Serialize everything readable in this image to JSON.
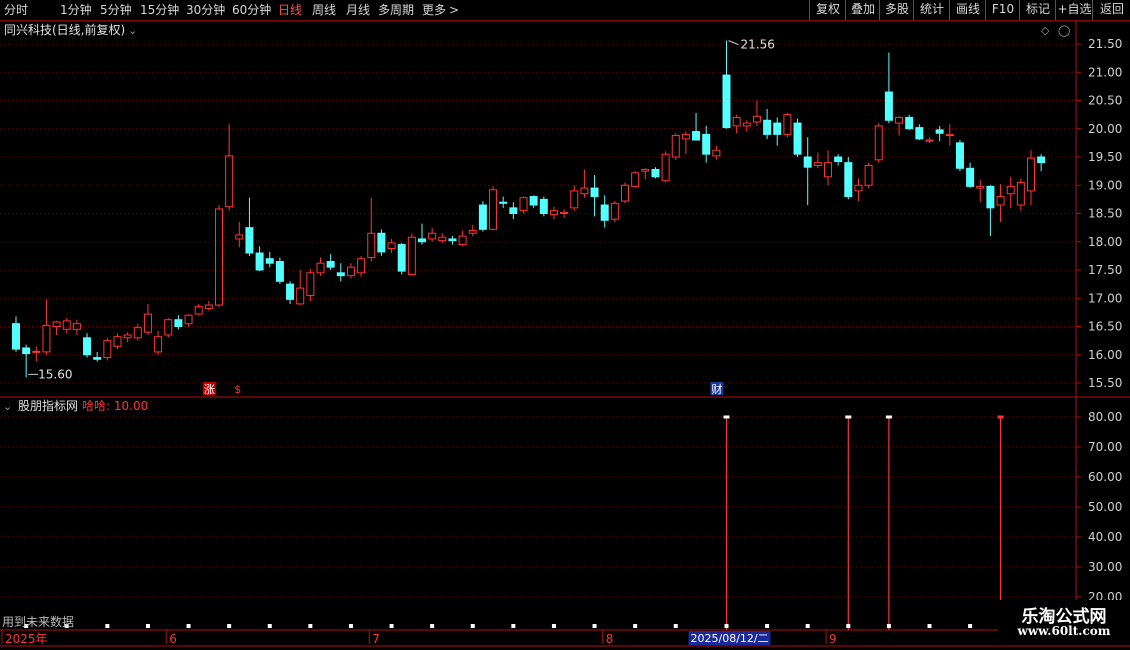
{
  "toolbar": {
    "periods": [
      "分时",
      "1分钟",
      "5分钟",
      "15分钟",
      "30分钟",
      "60分钟",
      "日线",
      "周线",
      "月线",
      "多周期",
      "更多"
    ],
    "active_period": "日线",
    "more_arrow": ">",
    "right_buttons": [
      "复权",
      "叠加",
      "多股",
      "统计",
      "画线",
      "F10",
      "标记",
      "+自选",
      "返回"
    ]
  },
  "price_panel": {
    "title": "同兴科技(日线,前复权)",
    "title_icon": "chevron-down-icon",
    "axis_labels": [
      "21.50",
      "21.00",
      "20.50",
      "20.00",
      "19.50",
      "19.00",
      "18.50",
      "18.00",
      "17.50",
      "17.00",
      "16.50",
      "16.00",
      "15.50"
    ],
    "high_label": "21.56",
    "low_label": "15.60",
    "markers": [
      {
        "text": "涨",
        "color": "#ffffff",
        "bg": "#c00000"
      },
      {
        "text": "$",
        "color": "#ff3030",
        "bg": ""
      },
      {
        "text": "财",
        "color": "#ffffff",
        "bg": "#1a3a9a"
      }
    ]
  },
  "indicator_panel": {
    "title": "股朋指标网",
    "param": "哈哈: 10.00",
    "axis_labels": [
      "80.00",
      "70.00",
      "60.00",
      "50.00",
      "40.00",
      "30.00",
      "20.00"
    ],
    "note": "用到未来数据"
  },
  "x_axis": {
    "labels": [
      "2025年",
      "6",
      "7",
      "8",
      "9"
    ],
    "cursor_date": "2025/08/12/二"
  },
  "watermark": {
    "line1": "乐淘公式网",
    "line2": "www.60lt.com"
  },
  "colors": {
    "up": "#ff3333",
    "down": "#54ffff",
    "frame": "#b01010",
    "grid": "#6e0000",
    "axis_text": "#d0d0d0"
  },
  "chart_data": {
    "type": "candlestick",
    "price_ylim": [
      15.3,
      21.75
    ],
    "indicator_ylim": [
      18,
      82
    ],
    "candles": [
      {
        "o": 16.55,
        "h": 16.68,
        "l": 16.05,
        "c": 16.1
      },
      {
        "o": 16.12,
        "h": 16.18,
        "l": 15.6,
        "c": 16.02
      },
      {
        "o": 16.05,
        "h": 16.15,
        "l": 15.88,
        "c": 16.06
      },
      {
        "o": 16.05,
        "h": 16.98,
        "l": 16.0,
        "c": 16.52
      },
      {
        "o": 16.5,
        "h": 16.6,
        "l": 16.35,
        "c": 16.58
      },
      {
        "o": 16.45,
        "h": 16.65,
        "l": 16.38,
        "c": 16.6
      },
      {
        "o": 16.45,
        "h": 16.62,
        "l": 16.35,
        "c": 16.55
      },
      {
        "o": 16.3,
        "h": 16.38,
        "l": 15.95,
        "c": 16.0
      },
      {
        "o": 15.95,
        "h": 16.05,
        "l": 15.88,
        "c": 15.92
      },
      {
        "o": 15.95,
        "h": 16.3,
        "l": 15.9,
        "c": 16.25
      },
      {
        "o": 16.15,
        "h": 16.38,
        "l": 16.1,
        "c": 16.32
      },
      {
        "o": 16.3,
        "h": 16.4,
        "l": 16.22,
        "c": 16.35
      },
      {
        "o": 16.3,
        "h": 16.55,
        "l": 16.25,
        "c": 16.48
      },
      {
        "o": 16.4,
        "h": 16.9,
        "l": 16.35,
        "c": 16.72
      },
      {
        "o": 16.05,
        "h": 16.42,
        "l": 16.0,
        "c": 16.32
      },
      {
        "o": 16.35,
        "h": 16.65,
        "l": 16.3,
        "c": 16.62
      },
      {
        "o": 16.62,
        "h": 16.7,
        "l": 16.45,
        "c": 16.5
      },
      {
        "o": 16.55,
        "h": 16.72,
        "l": 16.5,
        "c": 16.7
      },
      {
        "o": 16.72,
        "h": 16.9,
        "l": 16.7,
        "c": 16.85
      },
      {
        "o": 16.82,
        "h": 16.95,
        "l": 16.78,
        "c": 16.88
      },
      {
        "o": 16.88,
        "h": 18.65,
        "l": 16.85,
        "c": 18.58
      },
      {
        "o": 18.62,
        "h": 20.08,
        "l": 18.55,
        "c": 19.52
      },
      {
        "o": 18.05,
        "h": 18.35,
        "l": 17.9,
        "c": 18.12
      },
      {
        "o": 18.25,
        "h": 18.78,
        "l": 17.75,
        "c": 17.8
      },
      {
        "o": 17.8,
        "h": 17.92,
        "l": 17.48,
        "c": 17.5
      },
      {
        "o": 17.7,
        "h": 17.82,
        "l": 17.55,
        "c": 17.62
      },
      {
        "o": 17.65,
        "h": 17.72,
        "l": 17.25,
        "c": 17.3
      },
      {
        "o": 17.25,
        "h": 17.3,
        "l": 16.9,
        "c": 16.98
      },
      {
        "o": 16.9,
        "h": 17.5,
        "l": 16.88,
        "c": 17.18
      },
      {
        "o": 17.05,
        "h": 17.52,
        "l": 16.95,
        "c": 17.45
      },
      {
        "o": 17.45,
        "h": 17.72,
        "l": 17.4,
        "c": 17.62
      },
      {
        "o": 17.65,
        "h": 17.78,
        "l": 17.5,
        "c": 17.55
      },
      {
        "o": 17.45,
        "h": 17.62,
        "l": 17.3,
        "c": 17.4
      },
      {
        "o": 17.4,
        "h": 17.62,
        "l": 17.35,
        "c": 17.55
      },
      {
        "o": 17.45,
        "h": 17.75,
        "l": 17.38,
        "c": 17.7
      },
      {
        "o": 17.72,
        "h": 18.78,
        "l": 17.65,
        "c": 18.15
      },
      {
        "o": 18.15,
        "h": 18.22,
        "l": 17.75,
        "c": 17.82
      },
      {
        "o": 17.88,
        "h": 18.05,
        "l": 17.8,
        "c": 17.98
      },
      {
        "o": 17.95,
        "h": 17.98,
        "l": 17.42,
        "c": 17.48
      },
      {
        "o": 17.42,
        "h": 18.15,
        "l": 17.4,
        "c": 18.08
      },
      {
        "o": 18.05,
        "h": 18.32,
        "l": 17.95,
        "c": 18.0
      },
      {
        "o": 18.05,
        "h": 18.25,
        "l": 18.0,
        "c": 18.15
      },
      {
        "o": 18.02,
        "h": 18.15,
        "l": 17.98,
        "c": 18.08
      },
      {
        "o": 18.05,
        "h": 18.1,
        "l": 17.95,
        "c": 18.02
      },
      {
        "o": 17.95,
        "h": 18.2,
        "l": 17.92,
        "c": 18.1
      },
      {
        "o": 18.15,
        "h": 18.3,
        "l": 18.1,
        "c": 18.2
      },
      {
        "o": 18.65,
        "h": 18.72,
        "l": 18.18,
        "c": 18.22
      },
      {
        "o": 18.22,
        "h": 18.98,
        "l": 18.2,
        "c": 18.92
      },
      {
        "o": 18.7,
        "h": 18.8,
        "l": 18.6,
        "c": 18.68
      },
      {
        "o": 18.6,
        "h": 18.7,
        "l": 18.4,
        "c": 18.5
      },
      {
        "o": 18.55,
        "h": 18.8,
        "l": 18.5,
        "c": 18.78
      },
      {
        "o": 18.8,
        "h": 18.82,
        "l": 18.6,
        "c": 18.65
      },
      {
        "o": 18.75,
        "h": 18.8,
        "l": 18.45,
        "c": 18.5
      },
      {
        "o": 18.48,
        "h": 18.62,
        "l": 18.4,
        "c": 18.55
      },
      {
        "o": 18.5,
        "h": 18.58,
        "l": 18.42,
        "c": 18.52
      },
      {
        "o": 18.6,
        "h": 19.0,
        "l": 18.55,
        "c": 18.9
      },
      {
        "o": 18.85,
        "h": 19.28,
        "l": 18.78,
        "c": 18.95
      },
      {
        "o": 18.95,
        "h": 19.18,
        "l": 18.45,
        "c": 18.8
      },
      {
        "o": 18.65,
        "h": 18.82,
        "l": 18.25,
        "c": 18.38
      },
      {
        "o": 18.4,
        "h": 18.72,
        "l": 18.35,
        "c": 18.68
      },
      {
        "o": 18.72,
        "h": 19.05,
        "l": 18.68,
        "c": 19.0
      },
      {
        "o": 18.98,
        "h": 19.25,
        "l": 18.95,
        "c": 19.22
      },
      {
        "o": 19.25,
        "h": 19.3,
        "l": 19.1,
        "c": 19.28
      },
      {
        "o": 19.28,
        "h": 19.32,
        "l": 19.12,
        "c": 19.15
      },
      {
        "o": 19.08,
        "h": 19.6,
        "l": 19.05,
        "c": 19.55
      },
      {
        "o": 19.5,
        "h": 19.92,
        "l": 19.45,
        "c": 19.88
      },
      {
        "o": 19.82,
        "h": 19.95,
        "l": 19.55,
        "c": 19.9
      },
      {
        "o": 19.95,
        "h": 20.28,
        "l": 19.85,
        "c": 19.8
      },
      {
        "o": 19.9,
        "h": 20.05,
        "l": 19.4,
        "c": 19.55
      },
      {
        "o": 19.52,
        "h": 19.7,
        "l": 19.45,
        "c": 19.62
      },
      {
        "o": 20.95,
        "h": 21.56,
        "l": 20.0,
        "c": 20.02
      },
      {
        "o": 20.05,
        "h": 20.25,
        "l": 19.92,
        "c": 20.2
      },
      {
        "o": 20.05,
        "h": 20.15,
        "l": 19.95,
        "c": 20.1
      },
      {
        "o": 20.12,
        "h": 20.5,
        "l": 20.05,
        "c": 20.22
      },
      {
        "o": 20.15,
        "h": 20.35,
        "l": 19.82,
        "c": 19.9
      },
      {
        "o": 20.1,
        "h": 20.2,
        "l": 19.7,
        "c": 19.9
      },
      {
        "o": 19.9,
        "h": 20.28,
        "l": 19.85,
        "c": 20.25
      },
      {
        "o": 20.1,
        "h": 20.18,
        "l": 19.5,
        "c": 19.55
      },
      {
        "o": 19.5,
        "h": 19.85,
        "l": 18.65,
        "c": 19.32
      },
      {
        "o": 19.35,
        "h": 19.58,
        "l": 19.3,
        "c": 19.4
      },
      {
        "o": 19.15,
        "h": 19.62,
        "l": 19.0,
        "c": 19.4
      },
      {
        "o": 19.5,
        "h": 19.55,
        "l": 19.35,
        "c": 19.42
      },
      {
        "o": 19.4,
        "h": 19.5,
        "l": 18.75,
        "c": 18.8
      },
      {
        "o": 18.9,
        "h": 19.12,
        "l": 18.72,
        "c": 19.0
      },
      {
        "o": 19.0,
        "h": 19.4,
        "l": 18.95,
        "c": 19.35
      },
      {
        "o": 19.45,
        "h": 20.1,
        "l": 19.4,
        "c": 20.05
      },
      {
        "o": 20.65,
        "h": 21.35,
        "l": 20.1,
        "c": 20.15
      },
      {
        "o": 20.1,
        "h": 20.22,
        "l": 19.88,
        "c": 20.2
      },
      {
        "o": 20.2,
        "h": 20.25,
        "l": 19.98,
        "c": 20.0
      },
      {
        "o": 20.02,
        "h": 20.08,
        "l": 19.8,
        "c": 19.82
      },
      {
        "o": 19.78,
        "h": 19.85,
        "l": 19.75,
        "c": 19.8
      },
      {
        "o": 19.98,
        "h": 20.05,
        "l": 19.78,
        "c": 19.92
      },
      {
        "o": 19.88,
        "h": 20.08,
        "l": 19.7,
        "c": 19.9
      },
      {
        "o": 19.75,
        "h": 19.8,
        "l": 19.25,
        "c": 19.3
      },
      {
        "o": 19.3,
        "h": 19.4,
        "l": 18.95,
        "c": 18.98
      },
      {
        "o": 18.95,
        "h": 19.1,
        "l": 18.7,
        "c": 18.98
      },
      {
        "o": 18.98,
        "h": 19.0,
        "l": 18.1,
        "c": 18.6
      },
      {
        "o": 18.65,
        "h": 19.02,
        "l": 18.35,
        "c": 18.8
      },
      {
        "o": 18.85,
        "h": 19.15,
        "l": 18.6,
        "c": 18.98
      },
      {
        "o": 18.65,
        "h": 19.12,
        "l": 18.55,
        "c": 19.05
      },
      {
        "o": 18.9,
        "h": 19.62,
        "l": 18.65,
        "c": 19.48
      },
      {
        "o": 19.5,
        "h": 19.55,
        "l": 19.25,
        "c": 19.4
      }
    ],
    "indicator_bars": [
      {
        "i": 70,
        "value": 80
      },
      {
        "i": 82,
        "value": 80
      },
      {
        "i": 86,
        "value": 80
      },
      {
        "i": 97,
        "value": 80
      }
    ],
    "indicator_markers": [
      {
        "i": 70,
        "value": 80,
        "color": "#ffffff"
      },
      {
        "i": 82,
        "value": 80,
        "color": "#ffffff"
      },
      {
        "i": 86,
        "value": 80,
        "color": "#ffffff"
      },
      {
        "i": 97,
        "value": 80,
        "color": "#ff3333"
      }
    ],
    "baseline_dots": [
      1,
      5,
      9,
      13,
      17,
      21,
      25,
      29,
      33,
      37,
      41,
      45,
      49,
      53,
      57,
      61,
      65,
      70,
      74,
      78,
      82,
      86,
      90,
      94
    ],
    "month_ticks": [
      {
        "i": 0,
        "label": "2025年"
      },
      {
        "i": 15,
        "label": "6"
      },
      {
        "i": 35,
        "label": "7"
      },
      {
        "i": 58,
        "label": "8"
      },
      {
        "i": 80,
        "label": "9"
      }
    ],
    "marker_positions": [
      {
        "i": 19,
        "marker": 0
      },
      {
        "i": 22,
        "marker": 1
      },
      {
        "i": 69,
        "marker": 2
      }
    ],
    "high_index": 70,
    "low_index": 1,
    "cursor_index": 70
  }
}
